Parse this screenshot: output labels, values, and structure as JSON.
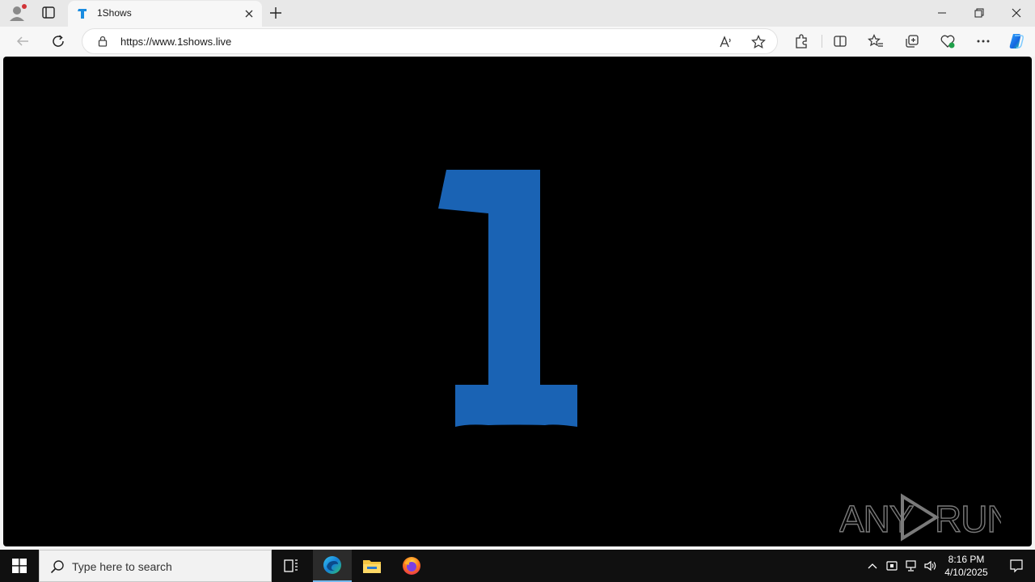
{
  "browser": {
    "tab": {
      "title": "1Shows",
      "favicon": "1shows-favicon-icon"
    },
    "address": {
      "url": "https://www.1shows.live"
    },
    "window_controls": [
      "minimize-icon",
      "restore-icon",
      "close-icon"
    ],
    "toolbar_icons": [
      "read-aloud-icon",
      "favorite-star-icon",
      "extensions-icon",
      "split-screen-icon",
      "favorites-icon",
      "collections-icon",
      "browser-essentials-icon",
      "more-icon",
      "copilot-icon"
    ]
  },
  "page": {
    "background": "#000000",
    "logo_color": "#1a63b4",
    "watermark": "ANY RUN"
  },
  "taskbar": {
    "search_placeholder": "Type here to search",
    "apps": [
      "task-view-icon",
      "edge-icon",
      "file-explorer-icon",
      "firefox-icon"
    ],
    "tray": [
      "chevron-up-icon",
      "security-icon",
      "network-icon",
      "volume-icon"
    ],
    "time": "8:16 PM",
    "date": "4/10/2025"
  }
}
